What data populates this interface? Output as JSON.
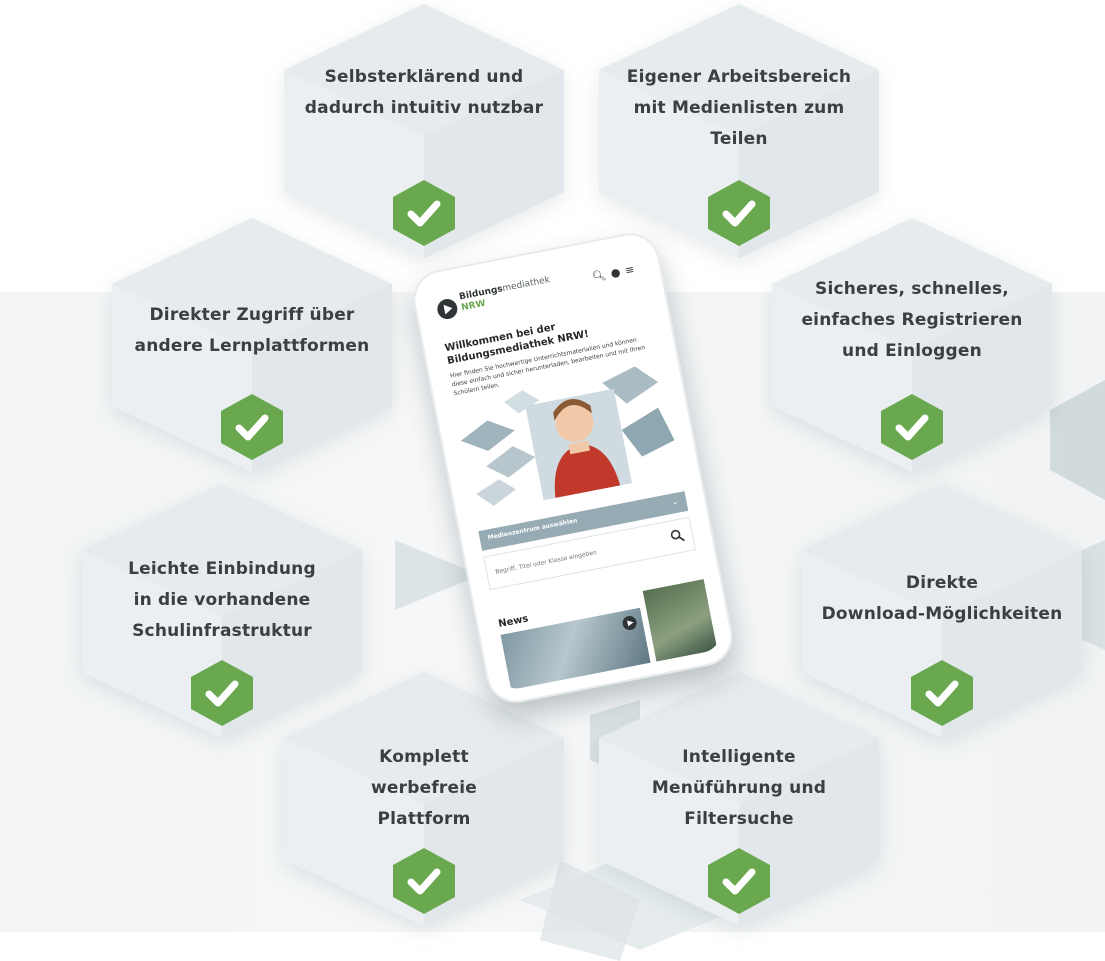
{
  "features": [
    {
      "id": "selbsterklaerend",
      "label": "Selbsterklärend und\ndadurch intuitiv nutzbar"
    },
    {
      "id": "arbeitsbereich",
      "label": "Eigener Arbeitsbereich\nmit Medienlisten zum Teilen"
    },
    {
      "id": "zugriff",
      "label": "Direkter Zugriff über\nandere Lernplattformen"
    },
    {
      "id": "registrieren",
      "label": "Sicheres, schnelles,\neinfaches Registrieren\nund Einloggen"
    },
    {
      "id": "einbindung",
      "label": "Leichte Einbindung\nin die vorhandene\nSchulinfrastruktur"
    },
    {
      "id": "download",
      "label": "Direkte\nDownload-Möglichkeiten"
    },
    {
      "id": "werbefrei",
      "label": "Komplett\nwerbefreie\nPlattform"
    },
    {
      "id": "menue",
      "label": "Intelligente\nMenüführung und\nFiltersuche"
    }
  ],
  "phone": {
    "logo_line1_bold": "Bildungs",
    "logo_line1_light": "mediathek",
    "logo_line2": "NRW",
    "header_icons": [
      "search-icon",
      "user-icon",
      "menu-icon"
    ],
    "welcome_title": "Willkommen bei der Bildungsmediathek NRW!",
    "welcome_text": "Hier finden Sie hochwertige Unterrichtsmaterialien und können diese einfach und sicher herunterladen, bearbeiten und mit Ihren Schülern teilen.",
    "dropdown_label": "Medienzentrum auswählen",
    "search_placeholder": "Begriff, Titel oder Klasse eingeben",
    "news_title": "News"
  },
  "colors": {
    "check_green": "#6aa84f",
    "cube_top": "#dfe6e9",
    "cube_left": "#e9eef0",
    "cube_right": "#d3dde1",
    "text_dark": "#3b3f42"
  }
}
